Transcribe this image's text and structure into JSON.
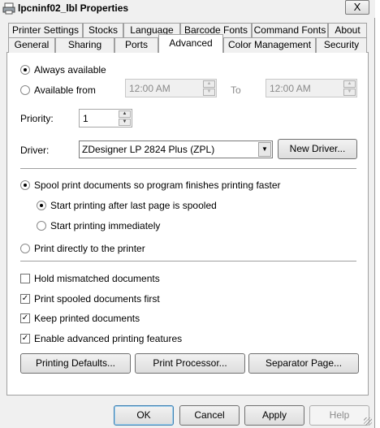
{
  "window": {
    "title": "lpcninf02_lbl Properties",
    "close_label": "X"
  },
  "tabs_top": [
    {
      "label": "Printer Settings"
    },
    {
      "label": "Stocks"
    },
    {
      "label": "Language"
    },
    {
      "label": "Barcode Fonts"
    },
    {
      "label": "Command Fonts"
    },
    {
      "label": "About"
    }
  ],
  "tabs_bottom": [
    {
      "label": "General"
    },
    {
      "label": "Sharing"
    },
    {
      "label": "Ports"
    },
    {
      "label": "Advanced",
      "active": true
    },
    {
      "label": "Color Management"
    },
    {
      "label": "Security"
    }
  ],
  "availability": {
    "always_label": "Always available",
    "from_label": "Available from",
    "from_time": "12:00 AM",
    "to_label": "To",
    "to_time": "12:00 AM",
    "selected": "always"
  },
  "priority": {
    "label": "Priority:",
    "value": "1"
  },
  "driver": {
    "label": "Driver:",
    "value": "ZDesigner LP 2824 Plus (ZPL)",
    "new_driver_label": "New Driver..."
  },
  "spooling": {
    "spool_label": "Spool print documents so program finishes printing faster",
    "after_last_label": "Start printing after last page is spooled",
    "immediately_label": "Start printing immediately",
    "direct_label": "Print directly to the printer"
  },
  "options": {
    "hold_mismatched_label": "Hold mismatched documents",
    "spooled_first_label": "Print spooled documents first",
    "keep_printed_label": "Keep printed documents",
    "advanced_features_label": "Enable advanced printing features",
    "hold_mismatched": false,
    "spooled_first": true,
    "keep_printed": true,
    "advanced_features": true
  },
  "panel_buttons": {
    "printing_defaults": "Printing Defaults...",
    "print_processor": "Print Processor...",
    "separator_page": "Separator Page..."
  },
  "footer": {
    "ok": "OK",
    "cancel": "Cancel",
    "apply": "Apply",
    "help": "Help"
  },
  "check_glyph": "✓",
  "spin_up_glyph": "▲",
  "spin_down_glyph": "▼"
}
